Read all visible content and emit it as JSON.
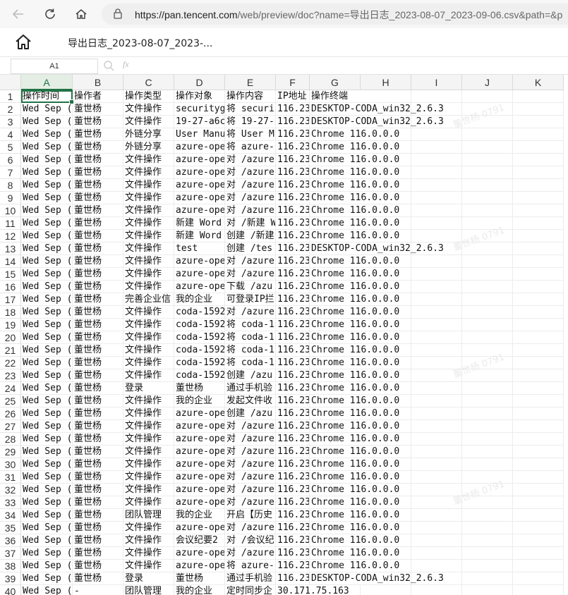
{
  "browser": {
    "url_host": "https://pan.tencent.com",
    "url_rest": "/web/preview/doc?name=导出日志_2023-08-07_2023-09-06.csv&path=&p"
  },
  "header": {
    "title": "导出日志_2023-08-07_2023-..."
  },
  "formula_bar": {
    "cell_ref": "A1",
    "fx": "fx"
  },
  "watermark": "董世杨 0791",
  "sheet": {
    "columns": [
      "A",
      "B",
      "C",
      "D",
      "E",
      "F",
      "G",
      "H",
      "I",
      "J",
      "K"
    ],
    "rows": [
      [
        "操作时间",
        "操作者",
        "操作类型",
        "操作对象",
        "操作内容",
        "IP地址",
        "操作终端"
      ],
      [
        "Wed Sep (",
        "董世杨",
        "文件操作",
        "securityg",
        "将 securi",
        "116.23",
        "DESKTOP-CODA_win32_2.6.3"
      ],
      [
        "Wed Sep (",
        "董世杨",
        "文件操作",
        "19-27-a6c",
        "将 19-27-",
        "116.23",
        "DESKTOP-CODA_win32_2.6.3"
      ],
      [
        "Wed Sep (",
        "董世杨",
        "外链分享",
        "User Manu",
        "将 User M",
        "116.23",
        "Chrome 116.0.0.0"
      ],
      [
        "Wed Sep (",
        "董世杨",
        "外链分享",
        "azure-ope",
        "将 azure-",
        "116.23",
        "Chrome 116.0.0.0"
      ],
      [
        "Wed Sep (",
        "董世杨",
        "文件操作",
        "azure-ope",
        "对 /azure",
        "116.23",
        "Chrome 116.0.0.0"
      ],
      [
        "Wed Sep (",
        "董世杨",
        "文件操作",
        "azure-ope",
        "对 /azure",
        "116.23",
        "Chrome 116.0.0.0"
      ],
      [
        "Wed Sep (",
        "董世杨",
        "文件操作",
        "azure-ope",
        "对 /azure",
        "116.23",
        "Chrome 116.0.0.0"
      ],
      [
        "Wed Sep (",
        "董世杨",
        "文件操作",
        "azure-ope",
        "对 /azure",
        "116.23",
        "Chrome 116.0.0.0"
      ],
      [
        "Wed Sep (",
        "董世杨",
        "文件操作",
        "azure-ope",
        "对 /azure",
        "116.23",
        "Chrome 116.0.0.0"
      ],
      [
        "Wed Sep (",
        "董世杨",
        "文件操作",
        "新建 Word",
        "对 /新建 Word 文",
        "116.23",
        "Chrome 116.0.0.0"
      ],
      [
        "Wed Sep (",
        "董世杨",
        "文件操作",
        "新建 Word",
        "创建 /新建",
        "116.23",
        "Chrome 116.0.0.0"
      ],
      [
        "Wed Sep (",
        "董世杨",
        "文件操作",
        "test",
        "创建 /tes",
        "116.23",
        "DESKTOP-CODA_win32_2.6.3"
      ],
      [
        "Wed Sep (",
        "董世杨",
        "文件操作",
        "azure-ope",
        "对 /azure",
        "116.23",
        "Chrome 116.0.0.0"
      ],
      [
        "Wed Sep (",
        "董世杨",
        "文件操作",
        "azure-ope",
        "对 /azure",
        "116.23",
        "Chrome 116.0.0.0"
      ],
      [
        "Wed Sep (",
        "董世杨",
        "文件操作",
        "azure-ope",
        "下载 /azu",
        "116.23",
        "Chrome 116.0.0.0"
      ],
      [
        "Wed Sep (",
        "董世杨",
        "完善企业信",
        "我的企业",
        "可登录IP拦",
        "116.23",
        "Chrome 116.0.0.0"
      ],
      [
        "Wed Sep (",
        "董世杨",
        "文件操作",
        "coda-1592",
        "对 /azure",
        "116.23",
        "Chrome 116.0.0.0"
      ],
      [
        "Wed Sep (",
        "董世杨",
        "文件操作",
        "coda-1592",
        "将 coda-1",
        "116.23",
        "Chrome 116.0.0.0"
      ],
      [
        "Wed Sep (",
        "董世杨",
        "文件操作",
        "coda-1592",
        "将 coda-1",
        "116.23",
        "Chrome 116.0.0.0"
      ],
      [
        "Wed Sep (",
        "董世杨",
        "文件操作",
        "coda-1592",
        "将 coda-1",
        "116.23",
        "Chrome 116.0.0.0"
      ],
      [
        "Wed Sep (",
        "董世杨",
        "文件操作",
        "coda-1592",
        "将 coda-1",
        "116.23",
        "Chrome 116.0.0.0"
      ],
      [
        "Wed Sep (",
        "董世杨",
        "文件操作",
        "coda-1592",
        "创建 /azu",
        "116.23",
        "Chrome 116.0.0.0"
      ],
      [
        "Wed Sep (",
        "董世杨",
        "登录",
        "董世杨",
        "通过手机验",
        "116.23",
        "Chrome 116.0.0.0"
      ],
      [
        "Wed Sep (",
        "董世杨",
        "文件操作",
        "我的企业",
        "发起文件收",
        "116.23",
        "Chrome 116.0.0.0"
      ],
      [
        "Wed Sep (",
        "董世杨",
        "文件操作",
        "azure-ope",
        "创建 /azu",
        "116.23",
        "Chrome 116.0.0.0"
      ],
      [
        "Wed Sep (",
        "董世杨",
        "文件操作",
        "azure-ope",
        "对 /azure",
        "116.23",
        "Chrome 116.0.0.0"
      ],
      [
        "Wed Sep (",
        "董世杨",
        "文件操作",
        "azure-ope",
        "对 /azure",
        "116.23",
        "Chrome 116.0.0.0"
      ],
      [
        "Wed Sep (",
        "董世杨",
        "文件操作",
        "azure-ope",
        "对 /azure",
        "116.23",
        "Chrome 116.0.0.0"
      ],
      [
        "Wed Sep (",
        "董世杨",
        "文件操作",
        "azure-ope",
        "对 /azure",
        "116.23",
        "Chrome 116.0.0.0"
      ],
      [
        "Wed Sep (",
        "董世杨",
        "文件操作",
        "azure-ope",
        "对 /azure",
        "116.23",
        "Chrome 116.0.0.0"
      ],
      [
        "Wed Sep (",
        "董世杨",
        "文件操作",
        "azure-ope",
        "对 /azure",
        "116.23",
        "Chrome 116.0.0.0"
      ],
      [
        "Wed Sep (",
        "董世杨",
        "文件操作",
        "azure-ope",
        "对 /azure",
        "116.23",
        "Chrome 116.0.0.0"
      ],
      [
        "Wed Sep (",
        "董世杨",
        "团队管理",
        "我的企业",
        "开启【历史",
        "116.23",
        "Chrome 116.0.0.0"
      ],
      [
        "Wed Sep (",
        "董世杨",
        "文件操作",
        "azure-ope",
        "对 /azure",
        "116.23",
        "Chrome 116.0.0.0"
      ],
      [
        "Wed Sep (",
        "董世杨",
        "文件操作",
        "会议纪要2",
        "对 /会议纪",
        "116.23",
        "Chrome 116.0.0.0"
      ],
      [
        "Wed Sep (",
        "董世杨",
        "文件操作",
        "azure-ope",
        "对 /azure",
        "116.23",
        "Chrome 116.0.0.0"
      ],
      [
        "Wed Sep (",
        "董世杨",
        "文件操作",
        "azure-ope",
        "将 azure-",
        "116.23",
        "Chrome 116.0.0.0"
      ],
      [
        "Wed Sep (",
        "董世杨",
        "登录",
        "董世杨",
        "通过手机验",
        "116.23",
        "DESKTOP-CODA_win32_2.6.3"
      ],
      [
        "Wed Sep (",
        "-",
        "团队管理",
        "我的企业",
        "定时同步企",
        "30.171.75.163",
        ""
      ]
    ]
  }
}
